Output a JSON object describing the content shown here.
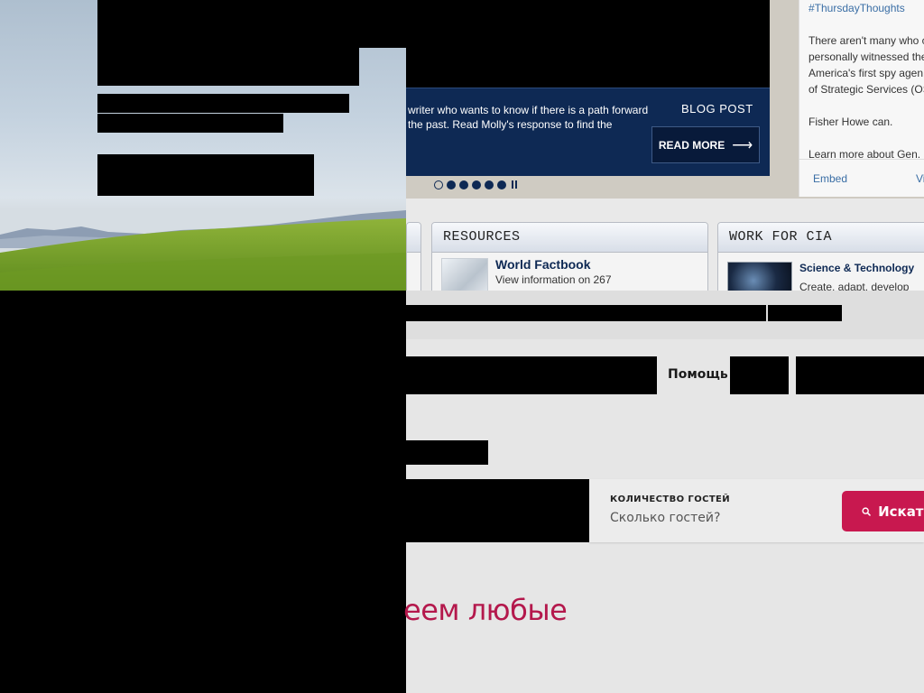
{
  "cia_page": {
    "slider": {
      "caption": "writer who wants to know if there is a path forward the past. Read Molly's response to find the",
      "caption_line1": "writer who wants to know if there is a path forward",
      "caption_line2": "the past. Read Molly's response to find the",
      "tag": "BLOG POST",
      "read_more_label": "READ MORE",
      "read_more_arrow": "⟶",
      "slide_count": 6,
      "active_slide": 1
    },
    "tweet": {
      "hashtag": "#ThursdayThoughts",
      "lines": [
        "There aren't many who c",
        "personally witnessed the",
        "America's first spy agen",
        "of Strategic Services (OS"
      ],
      "line_quote": "Fisher Howe can.",
      "line_learn": "Learn more about Gen. ",
      "embed_label": "Embed",
      "view_label": "Vi"
    },
    "boxes": {
      "resources": {
        "title": "RESOURCES",
        "item_title": "World Factbook",
        "item_desc": "View information on 267"
      },
      "work": {
        "title": "WORK FOR CIA",
        "item_title": "Science & Technology",
        "item_desc": "Create, adapt, develop an"
      }
    }
  },
  "booking_page": {
    "nav": {
      "help_label": "Помощь"
    },
    "search": {
      "guests_label": "КОЛИЧЕСТВО ГОСТЕЙ",
      "guests_placeholder": "Сколько гостей?",
      "search_label": "Искать"
    },
    "headline": "еем любые"
  },
  "colors": {
    "cia_navy": "#0e2954",
    "booking_accent": "#c8184f",
    "headline": "#b4184c"
  },
  "icons": [
    "search-icon",
    "arrow-right-icon",
    "pause-icon"
  ]
}
